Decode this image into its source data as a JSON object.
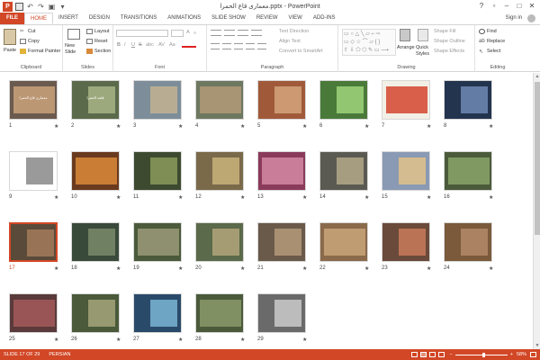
{
  "window": {
    "title": "معماری قاع الحمرا.pptx - PowerPoint",
    "controls": [
      "?",
      "▫",
      "–",
      "□",
      "✕"
    ]
  },
  "tabs": [
    "FILE",
    "HOME",
    "INSERT",
    "DESIGN",
    "TRANSITIONS",
    "ANIMATIONS",
    "SLIDE SHOW",
    "REVIEW",
    "VIEW",
    "ADD-INS"
  ],
  "active_tab": "HOME",
  "account": {
    "signin": "Sign in"
  },
  "ribbon": {
    "clipboard": {
      "label": "Clipboard",
      "paste": "Paste",
      "cut": "Cut",
      "copy": "Copy",
      "format_painter": "Format Painter"
    },
    "slides": {
      "label": "Slides",
      "new_slide": "New Slide",
      "layout": "Layout",
      "reset": "Reset",
      "section": "Section"
    },
    "font": {
      "label": "Font",
      "bold": "B",
      "italic": "I",
      "underline": "U",
      "strike": "S",
      "shadow": "abc",
      "spacing": "AV",
      "case": "Aa",
      "grow": "A",
      "shrink": "A"
    },
    "paragraph": {
      "label": "Paragraph",
      "text_direction": "Text Direction",
      "align_text": "Align Text",
      "smartart": "Convert to SmartArt"
    },
    "drawing": {
      "label": "Drawing",
      "arrange": "Arrange",
      "quick_styles": "Quick Styles",
      "shape_fill": "Shape Fill",
      "shape_outline": "Shape Outline",
      "shape_effects": "Shape Effects"
    },
    "editing": {
      "label": "Editing",
      "find": "Find",
      "replace": "Replace",
      "select": "Select"
    }
  },
  "slides": [
    {
      "n": "1",
      "bg": "#6b5a4e",
      "accent": "#c9a27a",
      "title": "معماری قاع الحمرا"
    },
    {
      "n": "2",
      "bg": "#5b6a4a",
      "accent": "#a8b486",
      "title": "قلعه الحمرا"
    },
    {
      "n": "3",
      "bg": "#7d8e9a",
      "accent": "#c2b392",
      "title": ""
    },
    {
      "n": "4",
      "bg": "#6d7860",
      "accent": "#b29a78",
      "title": ""
    },
    {
      "n": "5",
      "bg": "#a05a3a",
      "accent": "#d4a47c",
      "title": ""
    },
    {
      "n": "6",
      "bg": "#4a7a3a",
      "accent": "#9fd47a",
      "title": ""
    },
    {
      "n": "7",
      "bg": "#f2efe6",
      "accent": "#d5452e",
      "title": ""
    },
    {
      "n": "8",
      "bg": "#23344f",
      "accent": "#6f8ab4",
      "title": ""
    },
    {
      "n": "9",
      "bg": "#ffffff",
      "accent": "#888888",
      "title": ""
    },
    {
      "n": "10",
      "bg": "#6a3a1e",
      "accent": "#d98a3a",
      "title": ""
    },
    {
      "n": "11",
      "bg": "#3e4a30",
      "accent": "#8a9a5a",
      "title": ""
    },
    {
      "n": "12",
      "bg": "#7a6a4a",
      "accent": "#c9b27a",
      "title": ""
    },
    {
      "n": "13",
      "bg": "#8a3a5a",
      "accent": "#d48aa4",
      "title": ""
    },
    {
      "n": "14",
      "bg": "#5a5a52",
      "accent": "#b4a98a",
      "title": ""
    },
    {
      "n": "15",
      "bg": "#8a9ab4",
      "accent": "#e2c28a",
      "title": ""
    },
    {
      "n": "16",
      "bg": "#4a5a3a",
      "accent": "#8aa46a",
      "title": ""
    },
    {
      "n": "17",
      "bg": "#5a4a3a",
      "accent": "#a47a5a",
      "title": ""
    },
    {
      "n": "18",
      "bg": "#3a4a3a",
      "accent": "#7a8a6a",
      "title": ""
    },
    {
      "n": "19",
      "bg": "#4a5a3a",
      "accent": "#9a9a7a",
      "title": ""
    },
    {
      "n": "20",
      "bg": "#5a6a4a",
      "accent": "#b4a47a",
      "title": ""
    },
    {
      "n": "21",
      "bg": "#6a5a4a",
      "accent": "#b49a7a",
      "title": ""
    },
    {
      "n": "22",
      "bg": "#8a6a4a",
      "accent": "#c9a47a",
      "title": ""
    },
    {
      "n": "23",
      "bg": "#6a4a3a",
      "accent": "#c97a5a",
      "title": ""
    },
    {
      "n": "24",
      "bg": "#7a5a3a",
      "accent": "#b48a6a",
      "title": ""
    },
    {
      "n": "25",
      "bg": "#5a3a3a",
      "accent": "#a45a5a",
      "title": ""
    },
    {
      "n": "26",
      "bg": "#4a5a3a",
      "accent": "#a4a47a",
      "title": ""
    },
    {
      "n": "27",
      "bg": "#2a4a6a",
      "accent": "#7ab4d4",
      "title": ""
    },
    {
      "n": "28",
      "bg": "#4a5a3a",
      "accent": "#8a9a6a",
      "title": ""
    },
    {
      "n": "29",
      "bg": "#6a6a6a",
      "accent": "#cacaca",
      "title": ""
    }
  ],
  "selected_slide": "17",
  "status": {
    "slide_info": "SLIDE 17 OF 29",
    "language": "PERSIAN",
    "zoom": "58%",
    "zoom_minus": "−",
    "zoom_plus": "+"
  },
  "colors": {
    "accent": "#d24726",
    "selection": "#d24726"
  },
  "icons": [
    "save-icon",
    "undo-icon",
    "redo-icon",
    "start-from-beginning-icon",
    "customize-qat-icon",
    "help-icon",
    "restore-icon",
    "minimize-icon",
    "maximize-icon",
    "close-icon",
    "paste-icon",
    "cut-icon",
    "copy-icon",
    "format-painter-icon",
    "new-slide-icon",
    "layout-icon",
    "reset-icon",
    "section-icon",
    "find-icon",
    "replace-icon",
    "select-icon"
  ]
}
